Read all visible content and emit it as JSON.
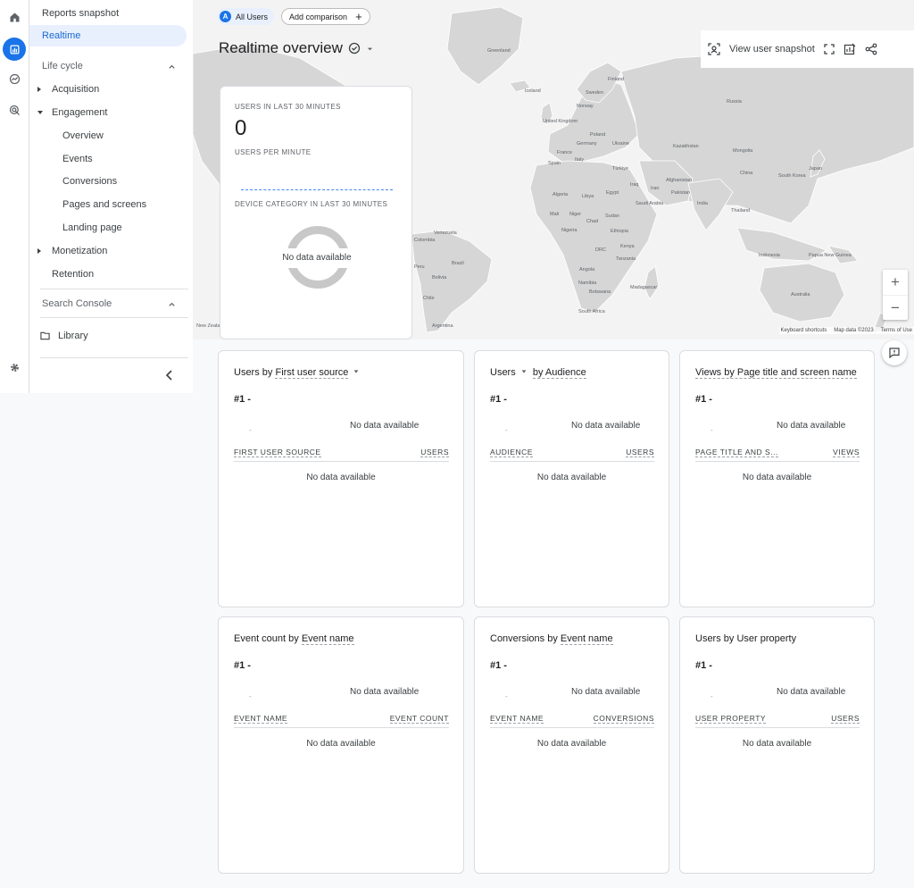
{
  "nav": {
    "reports_snapshot": "Reports snapshot",
    "realtime": "Realtime",
    "lifecycle": "Life cycle",
    "acquisition": "Acquisition",
    "engagement": "Engagement",
    "overview": "Overview",
    "events": "Events",
    "conversions": "Conversions",
    "pages_screens": "Pages and screens",
    "landing_page": "Landing page",
    "monetization": "Monetization",
    "retention": "Retention",
    "search_console": "Search Console",
    "library": "Library"
  },
  "header": {
    "segment_badge": "A",
    "segment": "All Users",
    "add_comparison": "Add comparison",
    "title": "Realtime overview",
    "view_snapshot": "View user snapshot"
  },
  "map": {
    "labels": [
      "Greenland",
      "Finland",
      "Iceland",
      "Sweden",
      "Norway",
      "Russia",
      "United Kingdom",
      "Poland",
      "Germany",
      "Ukraine",
      "France",
      "Italy",
      "Spain",
      "Kazakhstan",
      "Mongolia",
      "Türkiye",
      "Iraq",
      "Iran",
      "Afghanistan",
      "China",
      "Japan",
      "South Korea",
      "Pakistan",
      "India",
      "Thailand",
      "Algeria",
      "Libya",
      "Egypt",
      "Saudi Arabia",
      "Mali",
      "Niger",
      "Chad",
      "Sudan",
      "Nigeria",
      "Ethiopia",
      "Kenya",
      "DRC",
      "Tanzania",
      "Angola",
      "Namibia",
      "Botswana",
      "Madagascar",
      "South Africa",
      "Venezuela",
      "Colombia",
      "Peru",
      "Brazil",
      "Bolivia",
      "Chile",
      "Argentina",
      "Indonesia",
      "Papua New Guinea",
      "Australia",
      "New Zealand"
    ],
    "keyboard_shortcuts": "Keyboard shortcuts",
    "map_data": "Map data ©2023",
    "terms": "Terms of Use"
  },
  "summary": {
    "users_30": "USERS IN LAST 30 MINUTES",
    "users_count": "0",
    "per_minute": "USERS PER MINUTE",
    "device_category": "DEVICE CATEGORY IN LAST 30 MINUTES",
    "no_data": "No data available"
  },
  "cards": [
    {
      "title_a": "Users by ",
      "title_b": "First user source",
      "rank": "#1  -",
      "no_data": "No data available",
      "col_left": "FIRST USER SOURCE",
      "col_right": "USERS"
    },
    {
      "title_a": "Users",
      "title_b": "by Audience",
      "rank": "#1  -",
      "no_data": "No data available",
      "col_left": "AUDIENCE",
      "col_right": "USERS"
    },
    {
      "title_a": "Views by Page title and screen name",
      "title_b": "",
      "rank": "#1  -",
      "no_data": "No data available",
      "col_left": "PAGE TITLE AND S...",
      "col_right": "VIEWS"
    },
    {
      "title_a": "Event count by ",
      "title_b": "Event name",
      "rank": "#1  -",
      "no_data": "No data available",
      "col_left": "EVENT NAME",
      "col_right": "EVENT COUNT"
    },
    {
      "title_a": "Conversions by ",
      "title_b": "Event name",
      "rank": "#1  -",
      "no_data": "No data available",
      "col_left": "EVENT NAME",
      "col_right": "CONVERSIONS"
    },
    {
      "title_a": "Users by User property",
      "title_b": "",
      "rank": "#1  -",
      "no_data": "No data available",
      "col_left": "USER PROPERTY",
      "col_right": "USERS"
    }
  ],
  "colors": {
    "accent": "#1a73e8",
    "active_bg": "#e8f0fe",
    "land": "#d6d6d6"
  }
}
